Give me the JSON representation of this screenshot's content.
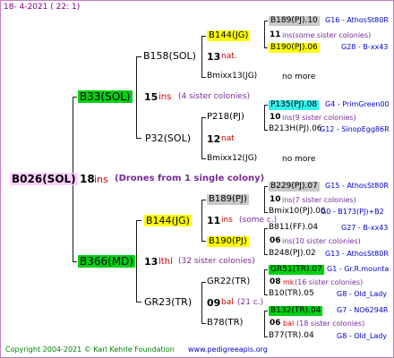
{
  "header": {
    "date": "18-  4-2021 (  22:   1)"
  },
  "root": {
    "id": "B026(SOL)",
    "num": "18",
    "ins": "ins",
    "note": "(Drones from 1 single colony)"
  },
  "gen1": [
    {
      "id": "B33(SOL)",
      "num": "15",
      "ins": "ins",
      "note": "(4 sister colonies)"
    },
    {
      "id": "B366(MD)",
      "num": "13",
      "ins": "lthl",
      "note": "(32 sister colonies)"
    }
  ],
  "gen2": [
    {
      "id": "B158(SOL)",
      "num": "13",
      "ins": "nat."
    },
    {
      "id": "P32(SOL)",
      "num": "12",
      "ins": "nat"
    },
    {
      "id": "B144(JG)",
      "num": "11",
      "ins": "ins",
      "note": "(some c.)"
    },
    {
      "id": "GR23(TR)",
      "num": "09",
      "ins": "bal",
      "note": "(21 c.)"
    }
  ],
  "gen3": [
    {
      "id": "B144(JG)"
    },
    {
      "id": "Bmixx13(JG)",
      "note": "no more"
    },
    {
      "id": "P218(PJ)"
    },
    {
      "id": "Bmixx12(JG)",
      "note": "no more"
    },
    {
      "id": "B189(PJ)"
    },
    {
      "id": "B190(PJ)"
    },
    {
      "id": "GR22(TR)"
    },
    {
      "id": "B78(TR)"
    }
  ],
  "gen4": [
    {
      "id": "B189(PJ).10",
      "info": "G16 - AthosSt80R"
    },
    {
      "num": "11",
      "note": "ins(some sister colonies)"
    },
    {
      "id": "B190(PJ).06",
      "info": "G28 - B-xx43"
    },
    {
      "id": "P135(PJ).08",
      "info": "G4 - PrimGreen00"
    },
    {
      "num": "10",
      "note": "ins(9 sister colonies)"
    },
    {
      "id": "B213H(PJ).06",
      "info": "G12 - SinopEgg86R"
    },
    {
      "id": "B229(PJ).07",
      "info": "G15 - AthosSt80R"
    },
    {
      "num": "10",
      "note": "ins(7 sister colonies)"
    },
    {
      "id": "Bmix10(PJ).06",
      "info": "G0 - B173(PJ)+B2"
    },
    {
      "id": "B811(FF).04",
      "info": "G27 - B-xx43"
    },
    {
      "num": "06",
      "note": "ins(10 sister colonies)"
    },
    {
      "id": "B248(PJ).02",
      "info": "G13 - AthosSt80R"
    },
    {
      "id": "GR51(TR).07",
      "info": "G1 - Gr.R.mounta"
    },
    {
      "num": "08",
      "ins": "mk",
      "note": "(16 sister colonies)"
    },
    {
      "id": "B10(TR).05",
      "info": "G8 - Old_Lady"
    },
    {
      "id": "B132(TR).04",
      "info": "G7 - NO6294R"
    },
    {
      "num": "06",
      "ins": "bal",
      "note": "(18 sister colonies)"
    },
    {
      "id": "B77(TR).04",
      "info": "G8 - Old_Lady"
    }
  ],
  "footer": {
    "copyright": "Copyright 2004-2021 © Karl Kehrle Foundation",
    "website": "www.pedigreeapis.org"
  },
  "colors": {
    "green": "#00d010",
    "yellow": "#ffff00",
    "grey": "#c8c8c8",
    "cyan": "#30f0f0",
    "pink": "#ffcfff",
    "blue": "#0000cc",
    "red": "#cc0000",
    "purple": "#7a2a9a"
  }
}
